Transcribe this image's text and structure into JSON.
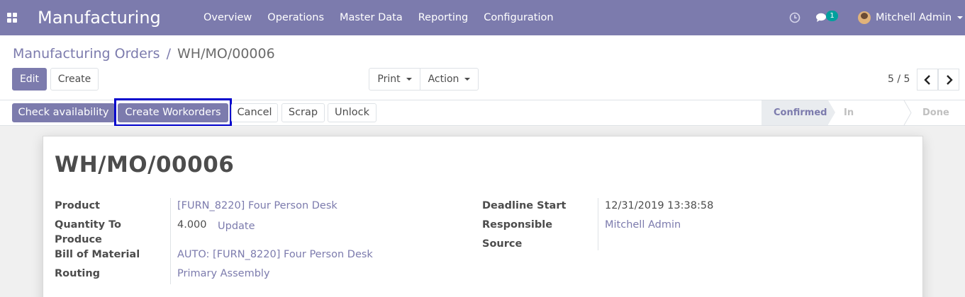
{
  "navbar": {
    "app_title": "Manufacturing",
    "menu": [
      "Overview",
      "Operations",
      "Master Data",
      "Reporting",
      "Configuration"
    ],
    "messages_count": "1",
    "user_name": "Mitchell Admin",
    "accent_color": "#7c7bad"
  },
  "breadcrumb": {
    "parent": "Manufacturing Orders",
    "separator": "/",
    "current": "WH/MO/00006"
  },
  "control": {
    "edit": "Edit",
    "create": "Create",
    "print": "Print",
    "action": "Action",
    "pager": "5 / 5"
  },
  "statusbar": {
    "buttons": {
      "check_availability": "Check availability",
      "create_workorders": "Create Workorders",
      "cancel": "Cancel",
      "scrap": "Scrap",
      "unlock": "Unlock"
    },
    "stages": [
      "Confirmed",
      "In Progress",
      "Done"
    ],
    "active_stage": "Confirmed"
  },
  "form": {
    "title": "WH/MO/00006",
    "left": {
      "product_label": "Product",
      "product_value": "[FURN_8220] Four Person Desk",
      "qty_label_1": "Quantity To",
      "qty_label_2": "Produce",
      "qty_value": "4.000",
      "qty_update": "Update",
      "bom_label": "Bill of Material",
      "bom_value": "AUTO: [FURN_8220] Four Person Desk",
      "routing_label": "Routing",
      "routing_value": "Primary Assembly"
    },
    "right": {
      "deadline_label": "Deadline Start",
      "deadline_value": "12/31/2019 13:38:58",
      "responsible_label": "Responsible",
      "responsible_value": "Mitchell Admin",
      "source_label": "Source"
    }
  }
}
